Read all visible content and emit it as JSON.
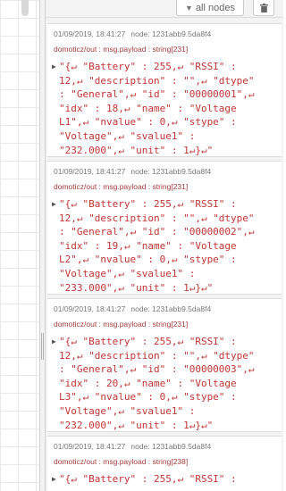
{
  "toolbar": {
    "filter_icon": "filter-icon",
    "filter_label": "all nodes",
    "delete_icon": "trash-icon"
  },
  "messages": [
    {
      "timestamp": "01/09/2019, 18:41:27",
      "node": "node: 1231abb9.5da8f4",
      "topic": "domoticz/out : msg.payload : string[231]",
      "lines": [
        "\"{↵ \"Battery\" : 255,↵ \"RSSI\" :",
        "12,↵ \"description\" : \"\",↵ \"dtype\"",
        ": \"General\",↵ \"id\" : \"00000001\",↵",
        "\"idx\" : 18,↵ \"name\" : \"Voltage",
        "L1\",↵ \"nvalue\" : 0,↵ \"stype\" :",
        "\"Voltage\",↵ \"svalue1\" :",
        "\"232.000\",↵ \"unit\" : 1↵}↵\""
      ]
    },
    {
      "timestamp": "01/09/2019, 18:41:27",
      "node": "node: 1231abb9.5da8f4",
      "topic": "domoticz/out : msg.payload : string[231]",
      "lines": [
        "\"{↵ \"Battery\" : 255,↵ \"RSSI\" :",
        "12,↵ \"description\" : \"\",↵ \"dtype\"",
        ": \"General\",↵ \"id\" : \"00000002\",↵",
        "\"idx\" : 19,↵ \"name\" : \"Voltage",
        "L2\",↵ \"nvalue\" : 0,↵ \"stype\" :",
        "\"Voltage\",↵ \"svalue1\" :",
        "\"233.000\",↵ \"unit\" : 1↵}↵\""
      ]
    },
    {
      "timestamp": "01/09/2019, 18:41:27",
      "node": "node: 1231abb9.5da8f4",
      "topic": "domoticz/out : msg.payload : string[231]",
      "lines": [
        "\"{↵ \"Battery\" : 255,↵ \"RSSI\" :",
        "12,↵ \"description\" : \"\",↵ \"dtype\"",
        ": \"General\",↵ \"id\" : \"00000003\",↵",
        "\"idx\" : 20,↵ \"name\" : \"Voltage",
        "L3\",↵ \"nvalue\" : 0,↵ \"stype\" :",
        "\"Voltage\",↵ \"svalue1\" :",
        "\"232.000\",↵ \"unit\" : 1↵}↵\""
      ]
    },
    {
      "timestamp": "01/09/2019, 18:41:27",
      "node": "node: 1231abb9.5da8f4",
      "topic": "domoticz/out : msg.payload : string[238]",
      "lines": [
        "\"{↵ \"Battery\" : 255,↵ \"RSSI\" :"
      ]
    }
  ]
}
